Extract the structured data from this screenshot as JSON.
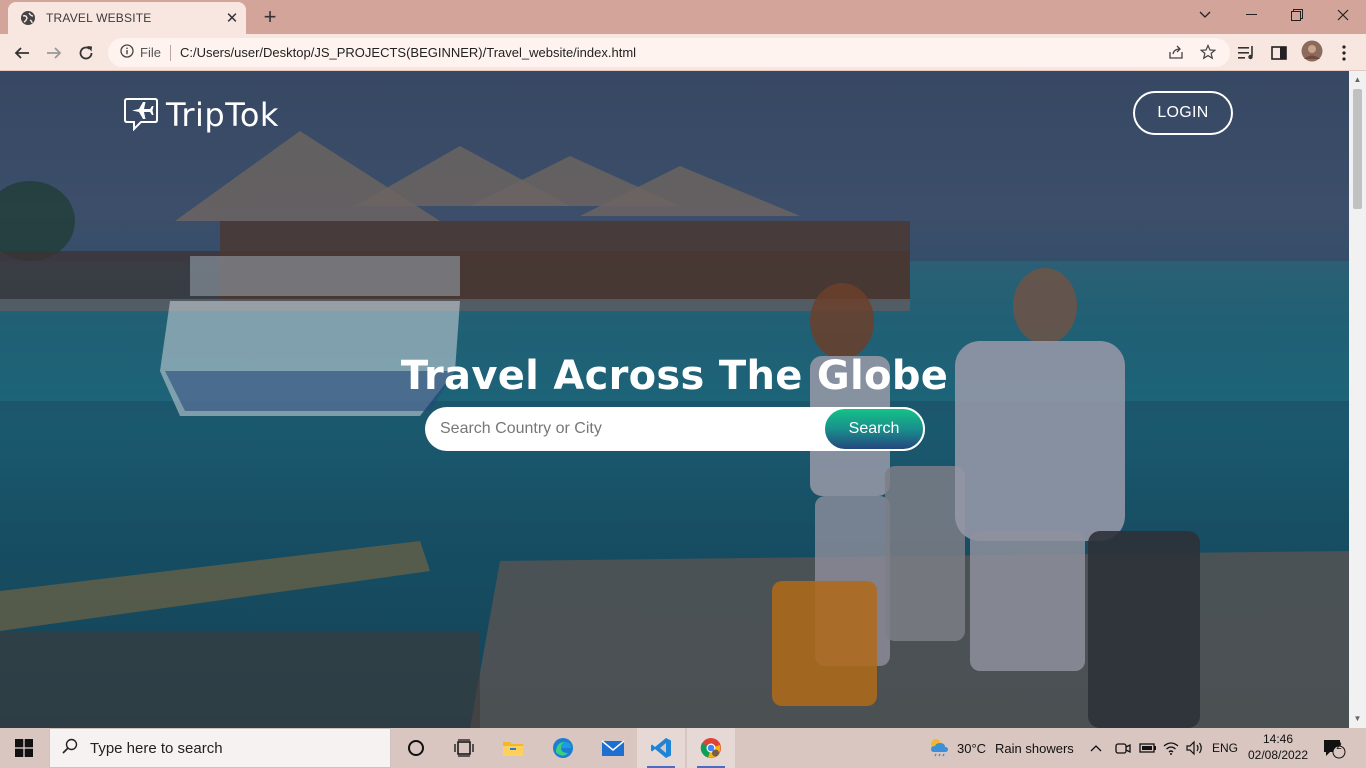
{
  "browser": {
    "tab_title": "TRAVEL WEBSITE",
    "new_tab_symbol": "+",
    "address": {
      "scheme_label": "File",
      "url": "C:/Users/user/Desktop/JS_PROJECTS(BEGINNER)/Travel_website/index.html"
    }
  },
  "page": {
    "logo_text": "TripTok",
    "login_label": "LOGIN",
    "hero_title": "Travel Across The Globe",
    "search": {
      "placeholder": "Search Country or City",
      "button_label": "Search"
    }
  },
  "taskbar": {
    "search_placeholder": "Type here to search",
    "weather": {
      "temperature": "30°C",
      "condition": "Rain showers"
    },
    "language": "ENG",
    "time": "14:46",
    "date": "02/08/2022",
    "notification_count": "2"
  },
  "colors": {
    "chrome_tabbar": "#d3a59a",
    "chrome_toolbar": "#f8e6e1",
    "search_button_top": "#13c287",
    "search_button_bottom": "#24477e",
    "taskbar": "#d9c6c1"
  }
}
